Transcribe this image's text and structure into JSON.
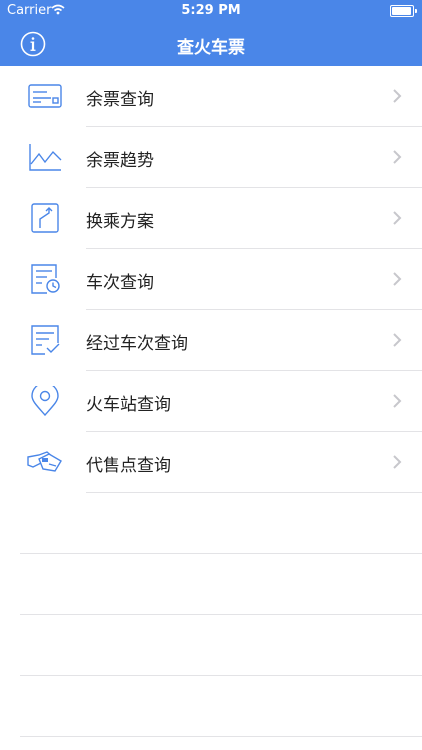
{
  "status": {
    "carrier": "Carrier",
    "time": "5:29 PM"
  },
  "nav": {
    "title": "查火车票",
    "info_icon": "info-icon"
  },
  "menu": [
    {
      "label": "余票查询",
      "icon": "ticket-card-icon"
    },
    {
      "label": "余票趋势",
      "icon": "trend-chart-icon"
    },
    {
      "label": "换乘方案",
      "icon": "transfer-route-icon"
    },
    {
      "label": "车次查询",
      "icon": "schedule-clock-icon"
    },
    {
      "label": "经过车次查询",
      "icon": "checklist-icon"
    },
    {
      "label": "火车站查询",
      "icon": "location-pin-icon"
    },
    {
      "label": "代售点查询",
      "icon": "ticket-agent-icon"
    }
  ],
  "colors": {
    "accent": "#4a86e8",
    "icon_stroke": "#4a86e8",
    "separator": "#e3e3e6",
    "chevron": "#c7c7cc"
  }
}
